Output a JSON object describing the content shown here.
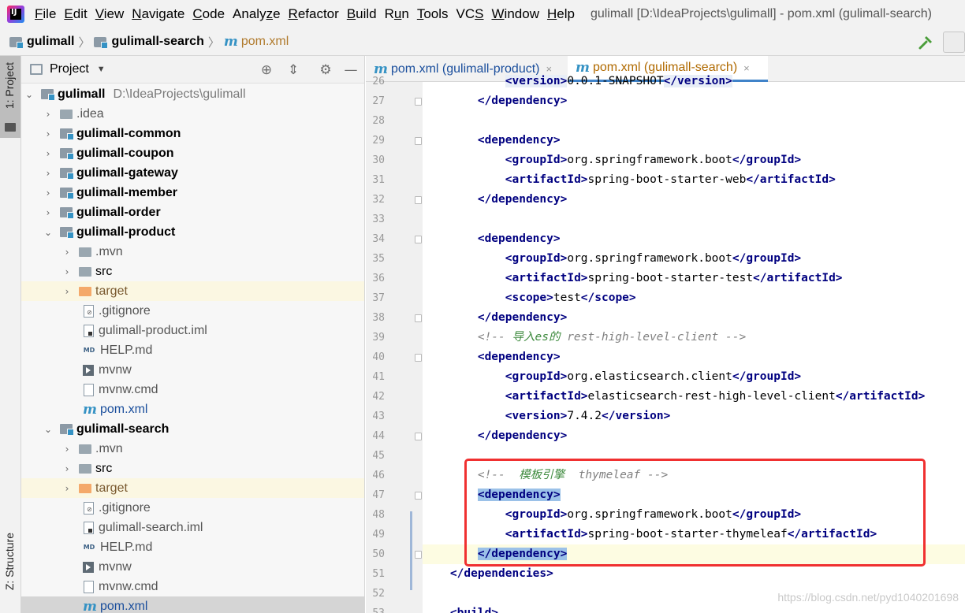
{
  "menubar": {
    "items": [
      {
        "mnemonic": "F",
        "rest": "ile"
      },
      {
        "mnemonic": "E",
        "rest": "dit"
      },
      {
        "mnemonic": "V",
        "rest": "iew"
      },
      {
        "mnemonic": "N",
        "rest": "avigate"
      },
      {
        "mnemonic": "C",
        "rest": "ode"
      },
      {
        "pre": "Analy",
        "mnemonic": "z",
        "rest": "e"
      },
      {
        "mnemonic": "R",
        "rest": "efactor"
      },
      {
        "mnemonic": "B",
        "rest": "uild"
      },
      {
        "pre": "R",
        "mnemonic": "u",
        "rest": "n"
      },
      {
        "mnemonic": "T",
        "rest": "ools"
      },
      {
        "pre": "VC",
        "mnemonic": "S",
        "rest": ""
      },
      {
        "mnemonic": "W",
        "rest": "indow"
      },
      {
        "mnemonic": "H",
        "rest": "elp"
      }
    ],
    "window_title": "gulimall [D:\\IdeaProjects\\gulimall] - pom.xml (gulimall-search)"
  },
  "navbar": {
    "crumbs": [
      "gulimall",
      "gulimall-search",
      "pom.xml"
    ]
  },
  "left_strip": {
    "project_label": "1: Project",
    "structure_label": "Z: Structure"
  },
  "project_panel": {
    "title": "Project",
    "rows": [
      {
        "label": "gulimall",
        "extra": "D:\\IdeaProjects\\gulimall"
      },
      {
        "label": ".idea"
      },
      {
        "label": "gulimall-common"
      },
      {
        "label": "gulimall-coupon"
      },
      {
        "label": "gulimall-gateway"
      },
      {
        "label": "gulimall-member"
      },
      {
        "label": "gulimall-order"
      },
      {
        "label": "gulimall-product"
      },
      {
        "label": ".mvn"
      },
      {
        "label": "src"
      },
      {
        "label": "target"
      },
      {
        "label": ".gitignore"
      },
      {
        "label": "gulimall-product.iml"
      },
      {
        "label": "HELP.md"
      },
      {
        "label": "mvnw"
      },
      {
        "label": "mvnw.cmd"
      },
      {
        "label": "pom.xml"
      },
      {
        "label": "gulimall-search"
      },
      {
        "label": ".mvn"
      },
      {
        "label": "src"
      },
      {
        "label": "target"
      },
      {
        "label": ".gitignore"
      },
      {
        "label": "gulimall-search.iml"
      },
      {
        "label": "HELP.md"
      },
      {
        "label": "mvnw"
      },
      {
        "label": "mvnw.cmd"
      },
      {
        "label": "pom.xml"
      }
    ]
  },
  "editor": {
    "tabs": [
      {
        "label": "pom.xml (gulimall-product)",
        "close": "×"
      },
      {
        "label": "pom.xml (gulimall-search)",
        "close": "×"
      }
    ],
    "line_numbers": [
      "26",
      "27",
      "28",
      "29",
      "30",
      "31",
      "32",
      "33",
      "34",
      "35",
      "36",
      "37",
      "38",
      "39",
      "40",
      "41",
      "42",
      "43",
      "44",
      "45",
      "46",
      "47",
      "48",
      "49",
      "50",
      "51",
      "52",
      "53"
    ],
    "lines": [
      {
        "indent": "        ",
        "parts": [
          [
            "t",
            "<version>"
          ],
          [
            "tx",
            "0.0.1-SNAPSHOT"
          ],
          [
            "t",
            "</version>"
          ]
        ]
      },
      {
        "indent": "    ",
        "parts": [
          [
            "t",
            "</dependency>"
          ]
        ]
      },
      {
        "indent": "",
        "parts": []
      },
      {
        "indent": "    ",
        "parts": [
          [
            "t",
            "<dependency>"
          ]
        ]
      },
      {
        "indent": "        ",
        "parts": [
          [
            "t",
            "<groupId>"
          ],
          [
            "tx",
            "org.springframework.boot"
          ],
          [
            "t",
            "</groupId>"
          ]
        ]
      },
      {
        "indent": "        ",
        "parts": [
          [
            "t",
            "<artifactId>"
          ],
          [
            "tx",
            "spring-boot-starter-web"
          ],
          [
            "t",
            "</artifactId>"
          ]
        ]
      },
      {
        "indent": "    ",
        "parts": [
          [
            "t",
            "</dependency>"
          ]
        ]
      },
      {
        "indent": "",
        "parts": []
      },
      {
        "indent": "    ",
        "parts": [
          [
            "t",
            "<dependency>"
          ]
        ]
      },
      {
        "indent": "        ",
        "parts": [
          [
            "t",
            "<groupId>"
          ],
          [
            "tx",
            "org.springframework.boot"
          ],
          [
            "t",
            "</groupId>"
          ]
        ]
      },
      {
        "indent": "        ",
        "parts": [
          [
            "t",
            "<artifactId>"
          ],
          [
            "tx",
            "spring-boot-starter-test"
          ],
          [
            "t",
            "</artifactId>"
          ]
        ]
      },
      {
        "indent": "        ",
        "parts": [
          [
            "t",
            "<scope>"
          ],
          [
            "tx",
            "test"
          ],
          [
            "t",
            "</scope>"
          ]
        ]
      },
      {
        "indent": "    ",
        "parts": [
          [
            "t",
            "</dependency>"
          ]
        ]
      },
      {
        "indent": "    ",
        "parts": [
          [
            "c",
            "<!-- "
          ],
          [
            "cg",
            "导入es的"
          ],
          [
            "c",
            " rest-high-level-client -->"
          ]
        ]
      },
      {
        "indent": "    ",
        "parts": [
          [
            "t",
            "<dependency>"
          ]
        ]
      },
      {
        "indent": "        ",
        "parts": [
          [
            "t",
            "<groupId>"
          ],
          [
            "tx",
            "org.elasticsearch.client"
          ],
          [
            "t",
            "</groupId>"
          ]
        ]
      },
      {
        "indent": "        ",
        "parts": [
          [
            "t",
            "<artifactId>"
          ],
          [
            "tx",
            "elasticsearch-rest-high-level-client"
          ],
          [
            "t",
            "</artifactId>"
          ]
        ]
      },
      {
        "indent": "        ",
        "parts": [
          [
            "t",
            "<version>"
          ],
          [
            "tx",
            "7.4.2"
          ],
          [
            "t",
            "</version>"
          ]
        ]
      },
      {
        "indent": "    ",
        "parts": [
          [
            "t",
            "</dependency>"
          ]
        ]
      },
      {
        "indent": "",
        "parts": []
      },
      {
        "indent": "    ",
        "parts": [
          [
            "c",
            "<!--  "
          ],
          [
            "cg",
            "模板引擎"
          ],
          [
            "c",
            "  thymeleaf -->"
          ]
        ]
      },
      {
        "indent": "    ",
        "parts": [
          [
            "tb",
            "<dependency>"
          ]
        ]
      },
      {
        "indent": "        ",
        "parts": [
          [
            "t",
            "<groupId>"
          ],
          [
            "tx",
            "org.springframework.boot"
          ],
          [
            "t",
            "</groupId>"
          ]
        ]
      },
      {
        "indent": "        ",
        "parts": [
          [
            "t",
            "<artifactId>"
          ],
          [
            "tx",
            "spring-boot-starter-thymeleaf"
          ],
          [
            "t",
            "</artifactId>"
          ]
        ]
      },
      {
        "indent": "    ",
        "parts": [
          [
            "tb",
            "</dependency>"
          ]
        ]
      },
      {
        "indent": "",
        "parts": [
          [
            "t",
            "</dependencies>"
          ]
        ]
      },
      {
        "indent": "",
        "parts": []
      },
      {
        "indent": "",
        "parts": [
          [
            "t",
            "<build>"
          ]
        ]
      }
    ]
  },
  "watermark": "https://blog.csdn.net/pyd1040201698",
  "colors": {
    "tag": "#000080",
    "comment": "#808080",
    "annotation_box": "#f03030",
    "brace_highlight": "#9bc1e8"
  }
}
